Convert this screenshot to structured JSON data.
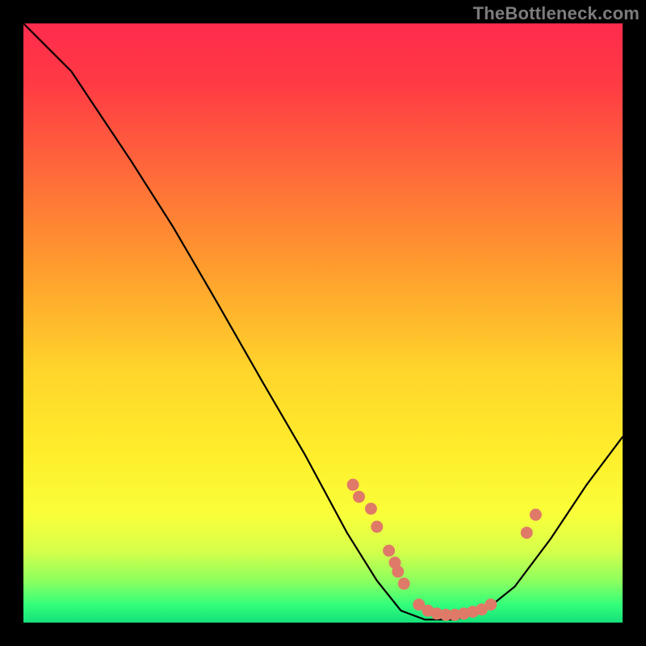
{
  "watermark": "TheBottleneck.com",
  "chart_data": {
    "type": "line",
    "title": "",
    "xlabel": "",
    "ylabel": "",
    "xlim": [
      0,
      100
    ],
    "ylim": [
      0,
      100
    ],
    "curve": [
      {
        "x": 0,
        "y": 100
      },
      {
        "x": 3,
        "y": 97
      },
      {
        "x": 8,
        "y": 92
      },
      {
        "x": 12,
        "y": 86
      },
      {
        "x": 18,
        "y": 77
      },
      {
        "x": 25,
        "y": 66
      },
      {
        "x": 32,
        "y": 54
      },
      {
        "x": 40,
        "y": 40
      },
      {
        "x": 47,
        "y": 28
      },
      {
        "x": 54,
        "y": 15
      },
      {
        "x": 59,
        "y": 7
      },
      {
        "x": 63,
        "y": 2
      },
      {
        "x": 67,
        "y": 0.5
      },
      {
        "x": 72,
        "y": 0.5
      },
      {
        "x": 77,
        "y": 2
      },
      {
        "x": 82,
        "y": 6
      },
      {
        "x": 88,
        "y": 14
      },
      {
        "x": 94,
        "y": 23
      },
      {
        "x": 100,
        "y": 31
      }
    ],
    "markers": [
      {
        "x": 55,
        "y": 23
      },
      {
        "x": 56,
        "y": 21
      },
      {
        "x": 58,
        "y": 19
      },
      {
        "x": 59,
        "y": 16
      },
      {
        "x": 61,
        "y": 12
      },
      {
        "x": 62,
        "y": 10
      },
      {
        "x": 62.5,
        "y": 8.5
      },
      {
        "x": 63.5,
        "y": 6.5
      },
      {
        "x": 66,
        "y": 3
      },
      {
        "x": 67.5,
        "y": 2
      },
      {
        "x": 69,
        "y": 1.5
      },
      {
        "x": 70.5,
        "y": 1.3
      },
      {
        "x": 72,
        "y": 1.3
      },
      {
        "x": 73.5,
        "y": 1.5
      },
      {
        "x": 75,
        "y": 1.8
      },
      {
        "x": 76.5,
        "y": 2.2
      },
      {
        "x": 78,
        "y": 3
      },
      {
        "x": 84,
        "y": 15
      },
      {
        "x": 85.5,
        "y": 18
      }
    ]
  }
}
